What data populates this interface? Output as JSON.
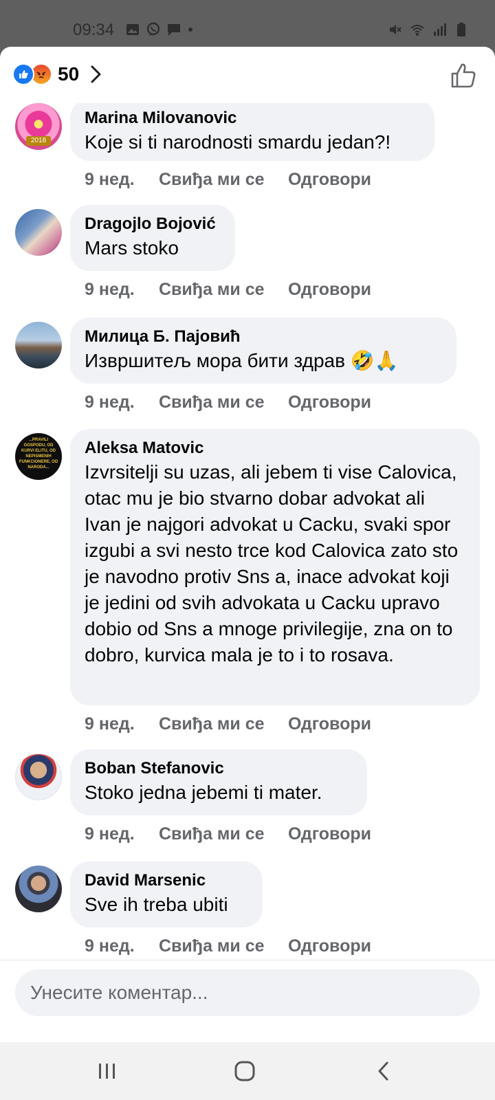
{
  "status": {
    "time": "09:34",
    "left_icons": [
      "image-icon",
      "viber-icon",
      "message-icon",
      "dot-icon"
    ],
    "right_icons": [
      "mute-icon",
      "wifi-icon",
      "signal-icon",
      "battery-icon"
    ]
  },
  "header": {
    "reaction_count": "50",
    "reactions": [
      "like-reaction-icon",
      "angry-reaction-icon"
    ]
  },
  "comments": [
    {
      "author": "Marina Milovanovic",
      "text": "Koje si ti narodnosti smardu jedan?!",
      "time": "9 нед.",
      "like": "Свиђа ми се",
      "reply": "Одговори"
    },
    {
      "author": "Dragojlo Bojović",
      "text": "Mars stoko",
      "time": "9 нед.",
      "like": "Свиђа ми се",
      "reply": "Одговори"
    },
    {
      "author": "Милица Б. Пајовић",
      "text": "Извршитељ мора бити здрав 🤣🙏",
      "time": "9 нед.",
      "like": "Свиђа ми се",
      "reply": "Одговори"
    },
    {
      "author": "Aleksa Matovic",
      "text": "Izvrsitelji su uzas, ali jebem ti vise Calovica, otac mu je bio stvarno dobar advokat ali Ivan je najgori advokat u Cacku, svaki spor izgubi a svi nesto trce kod Calovica zato sto je navodno protiv Sns a, inace advokat koji je jedini od svih advokata u Cacku upravo  dobio od Sns a mnoge privilegije, zna on to dobro, kurvica mala je to i to  rosava.",
      "time": "9 нед.",
      "like": "Свиђа ми се",
      "reply": "Одговори"
    },
    {
      "author": "Boban Stefanovic",
      "text": "Stoko jedna jebemi ti mater.",
      "time": "9 нед.",
      "like": "Свиђа ми се",
      "reply": "Одговори"
    },
    {
      "author": "David Marsenic",
      "text": "Sve ih treba ubiti",
      "time": "9 нед.",
      "like": "Свиђа ми се",
      "reply": "Одговори"
    }
  ],
  "avatar_badges": {
    "marina": "2018",
    "aleksa": "...PRAVILI GOSPODU, OD KURVI ELITU, OD NEPISMENIH FUNKCIONERE, OD NARODA..."
  },
  "input": {
    "placeholder": "Унесите коментар..."
  },
  "navbar": [
    "recents-icon",
    "home-icon",
    "back-icon"
  ],
  "colors": {
    "accent": "#1877f2",
    "bubble": "#f0f2f5",
    "meta_text": "#65676b",
    "text": "#050505"
  }
}
